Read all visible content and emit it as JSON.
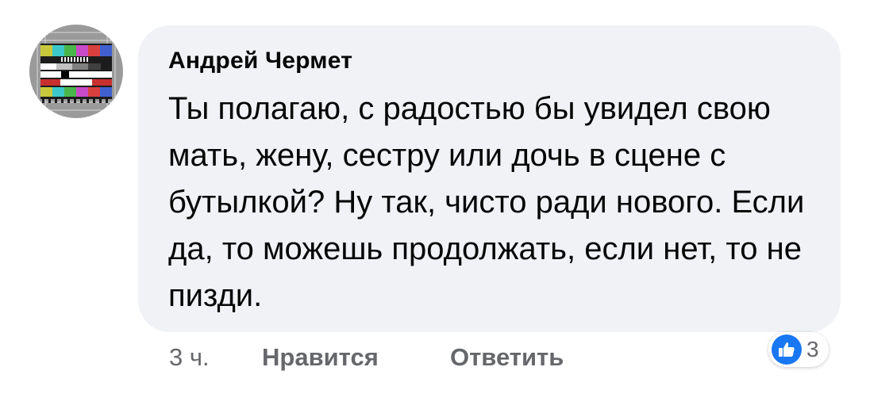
{
  "comment": {
    "author": "Андрей Чермет",
    "text": "Ты полагаю, с радостью бы увидел свою мать, жену, сестру или дочь в сцене с бутылкой? Ну так, чисто ради нового. Если да, то можешь продолжать, если нет, то не пизди.",
    "time": "3 ч.",
    "like_label": "Нравится",
    "reply_label": "Ответить",
    "reaction_count": "3",
    "reaction_icon": "thumbs-up-icon"
  },
  "avatar": {
    "icon": "tv-test-pattern-icon"
  },
  "colors": {
    "bubble_bg": "#f0f2f5",
    "text": "#050505",
    "secondary_text": "#65676b",
    "like_blue": "#1877f2"
  }
}
